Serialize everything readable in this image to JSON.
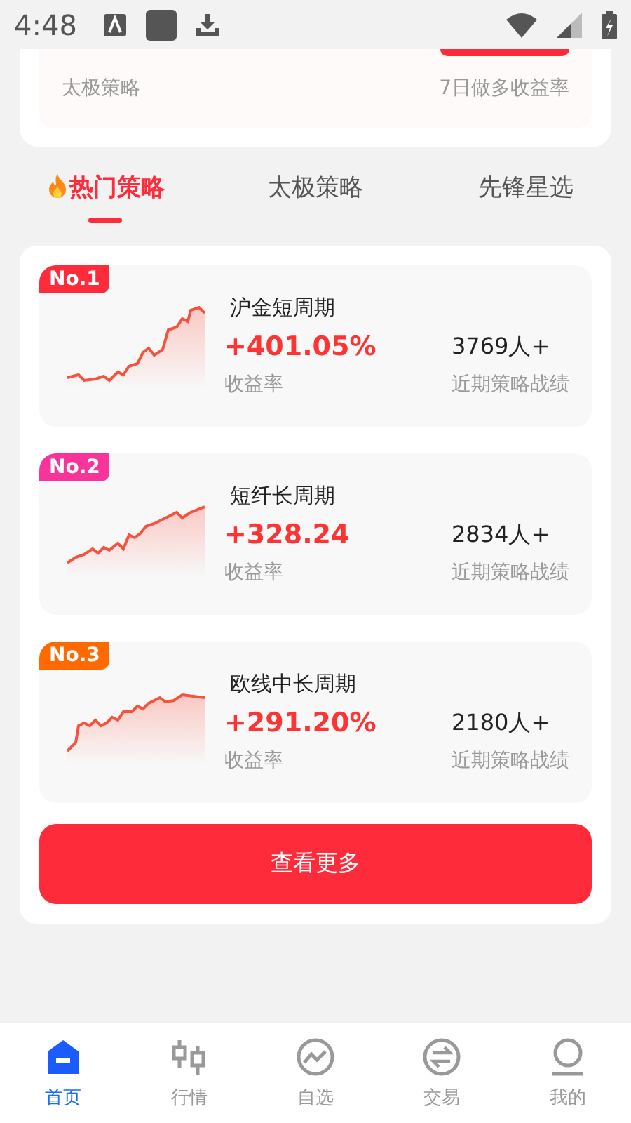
{
  "status_bar": {
    "time": "4:48"
  },
  "top_card": {
    "left_label": "太极策略",
    "right_label": "7日做多收益率"
  },
  "tabs": [
    {
      "label": "热门策略",
      "selected": true,
      "kind": "hot"
    },
    {
      "label": "太极策略",
      "selected": false,
      "kind": "plain"
    },
    {
      "label": "先锋星选",
      "selected": false,
      "kind": "plain"
    }
  ],
  "strategies": [
    {
      "rank": "No.1",
      "color": "#fe2b3a",
      "name": "沪金短周期",
      "return": "+401.05%",
      "return_label": "收益率",
      "participants": "3769人+",
      "participants_label": "近期策略战绩"
    },
    {
      "rank": "No.2",
      "color": "#f83399",
      "name": "短纤长周期",
      "return": "+328.24",
      "return_label": "收益率",
      "participants": "2834人+",
      "participants_label": "近期策略战绩"
    },
    {
      "rank": "No.3",
      "color": "#ff6a00",
      "name": "欧线中长周期",
      "return": "+291.20%",
      "return_label": "收益率",
      "participants": "2180人+",
      "participants_label": "近期策略战绩"
    }
  ],
  "more_button": "查看更多",
  "nav": [
    {
      "label": "首页",
      "selected": true,
      "kind": "home"
    },
    {
      "label": "行情",
      "selected": false,
      "kind": "market"
    },
    {
      "label": "自选",
      "selected": false,
      "kind": "watch"
    },
    {
      "label": "交易",
      "selected": false,
      "kind": "trade"
    },
    {
      "label": "我的",
      "selected": false,
      "kind": "me"
    }
  ]
}
